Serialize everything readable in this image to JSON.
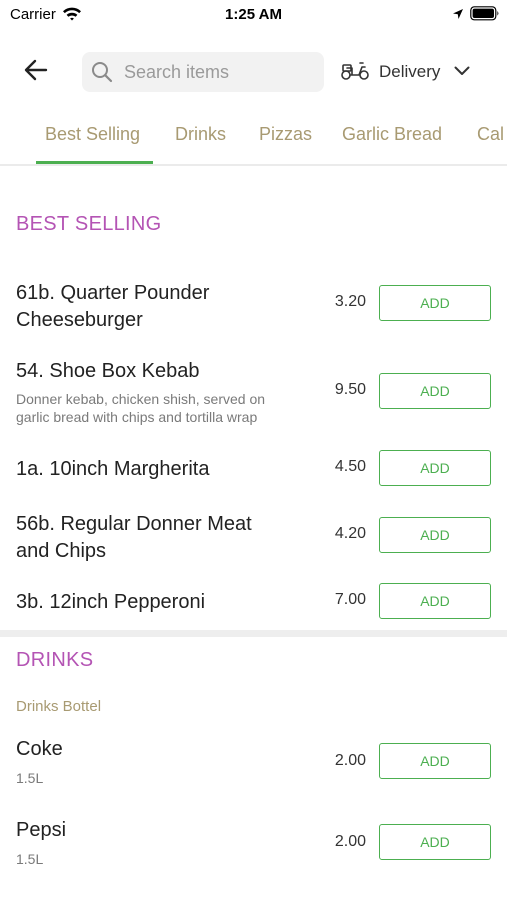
{
  "status_bar": {
    "carrier": "Carrier",
    "time": "1:25 AM"
  },
  "header": {
    "search_placeholder": "Search items",
    "delivery_label": "Delivery"
  },
  "tabs": [
    {
      "label": "Best Selling",
      "active": true
    },
    {
      "label": "Drinks"
    },
    {
      "label": "Pizzas"
    },
    {
      "label": "Garlic Bread"
    },
    {
      "label": "Cal"
    }
  ],
  "colors": {
    "accent_green": "#4caf50",
    "section_purple": "#b454b4",
    "tab_tan": "#a89a72"
  },
  "sections": {
    "best_selling": {
      "title": "BEST SELLING",
      "items": [
        {
          "name_line1": "61b. Quarter Pounder",
          "name_line2": "Cheeseburger",
          "price": "3.20",
          "button": "ADD"
        },
        {
          "name": "54. Shoe Box Kebab",
          "desc_line1": "Donner kebab, chicken shish, served on",
          "desc_line2": "garlic bread with chips and tortilla wrap",
          "price": "9.50",
          "button": "ADD"
        },
        {
          "name": "1a. 10inch Margherita",
          "price": "4.50",
          "button": "ADD"
        },
        {
          "name_line1": "56b. Regular Donner Meat",
          "name_line2": "and Chips",
          "price": "4.20",
          "button": "ADD"
        },
        {
          "name": "3b. 12inch Pepperoni",
          "price": "7.00",
          "button": "ADD"
        }
      ]
    },
    "drinks": {
      "title": "DRINKS",
      "subtitle": "Drinks Bottel",
      "items": [
        {
          "name": "Coke",
          "size": "1.5L",
          "price": "2.00",
          "button": "ADD"
        },
        {
          "name": "Pepsi",
          "size": "1.5L",
          "price": "2.00",
          "button": "ADD"
        }
      ]
    }
  }
}
